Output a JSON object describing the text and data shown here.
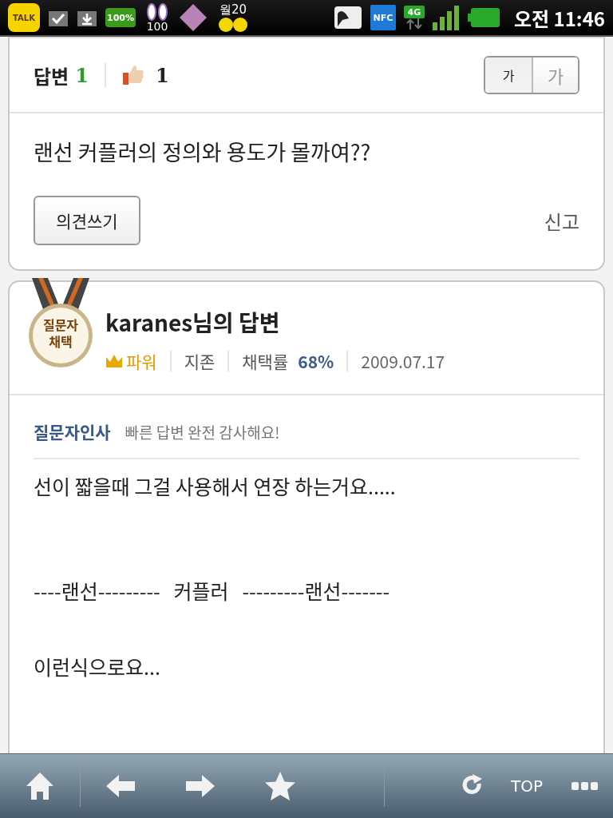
{
  "status_bar": {
    "talk_badge": "TALK",
    "battery_badge": "100%",
    "bunny_count": "100",
    "weather": "월20",
    "nfc_badge": "NFC",
    "network": "4G",
    "time": "오전 11:46"
  },
  "question": {
    "answer_label": "답변",
    "answer_count": "1",
    "like_count": "1",
    "font_sizes": [
      {
        "label": "가",
        "selected": true,
        "kind": "small"
      },
      {
        "label": "가",
        "selected": false,
        "kind": "large"
      }
    ],
    "text": "랜선 커플러의 정의와 용도가 몰까여??",
    "comment_button": "의견쓰기",
    "report_link": "신고"
  },
  "answer": {
    "medal_label": "질문자\n채택",
    "title": "karanes님의 답변",
    "rank": "파워",
    "level": "지존",
    "adoption_label": "채택률",
    "adoption_rate": "68%",
    "date": "2009.07.17",
    "greeting_label": "질문자인사",
    "greeting": "빠른 답변 완전 감사해요!",
    "paragraphs": [
      "선이 짧을때 그걸 사용해서 연장 하는거요.....",
      "----랜선---------   커플러   ---------랜선-------",
      "이런식으로요..."
    ]
  },
  "toolbar": {
    "top_label": "TOP"
  }
}
